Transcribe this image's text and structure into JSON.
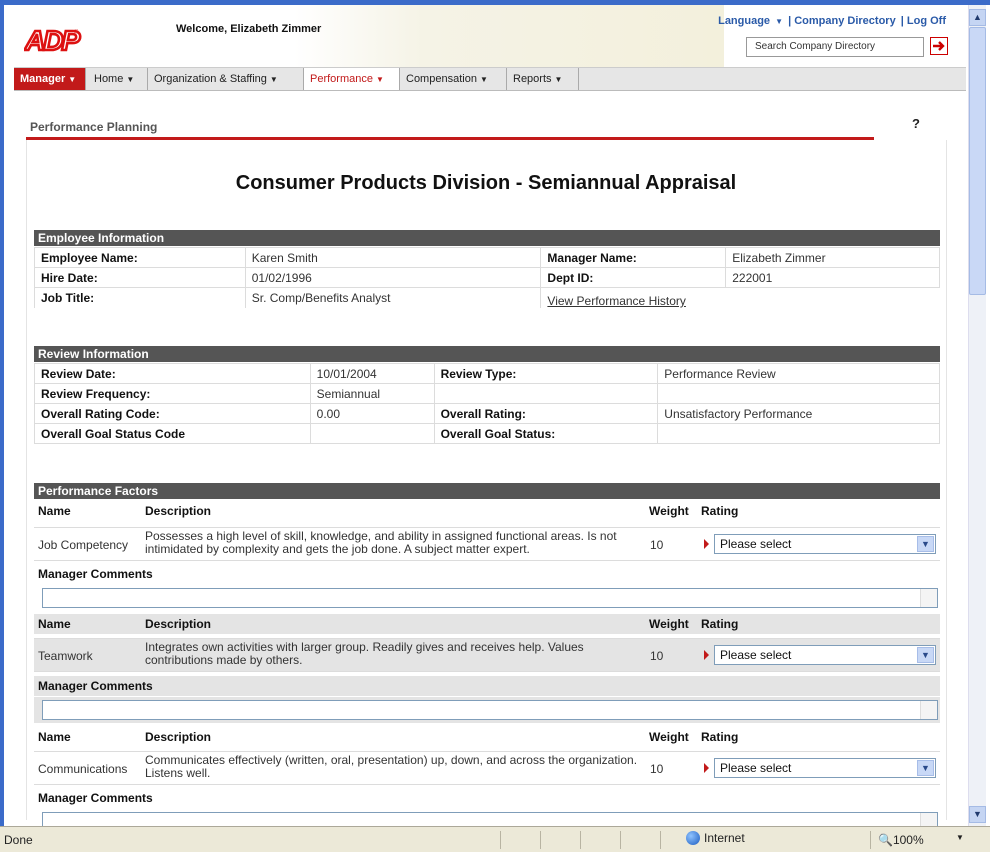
{
  "header": {
    "welcome": "Welcome, Elizabeth Zimmer",
    "language": "Language",
    "company_directory": "| Company Directory",
    "log_off": "| Log Off",
    "search_placeholder": "Search Company Directory"
  },
  "menu": {
    "manager": "Manager",
    "home": "Home",
    "org": "Organization & Staffing",
    "performance": "Performance",
    "compensation": "Compensation",
    "reports": "Reports"
  },
  "page": {
    "title": "Performance Planning",
    "help": "?",
    "heading": "Consumer Products Division - Semiannual Appraisal"
  },
  "employee": {
    "section": "Employee Information",
    "name_label": "Employee Name:",
    "name": "Karen Smith",
    "manager_label": "Manager Name:",
    "manager": "Elizabeth Zimmer",
    "hire_label": "Hire Date:",
    "hire": "01/02/1996",
    "dept_label": "Dept ID:",
    "dept": "222001",
    "job_label": "Job Title:",
    "job": "Sr. Comp/Benefits Analyst",
    "history_link": "View Performance History"
  },
  "review": {
    "section": "Review Information",
    "date_label": "Review Date:",
    "date": "10/01/2004",
    "type_label": "Review Type:",
    "type": "Performance Review",
    "freq_label": "Review Frequency:",
    "freq": "Semiannual",
    "rating_code_label": "Overall Rating Code:",
    "rating_code": "0.00",
    "rating_label": "Overall Rating:",
    "rating": "Unsatisfactory Performance",
    "goal_code_label": "Overall Goal Status Code",
    "goal_label": "Overall Goal Status:"
  },
  "factors": {
    "section": "Performance Factors",
    "col_name": "Name",
    "col_desc": "Description",
    "col_weight": "Weight",
    "col_rating": "Rating",
    "comments_label": "Manager Comments",
    "items": [
      {
        "name": "Job Competency",
        "desc": "Possesses a high level of skill, knowledge, and ability in assigned functional areas. Is not intimidated by complexity and gets the job done. A subject matter expert.",
        "weight": "10",
        "rating": "Please select"
      },
      {
        "name": "Teamwork",
        "desc": "Integrates own activities with larger group. Readily gives and receives help. Values contributions made by others.",
        "weight": "10",
        "rating": "Please select"
      },
      {
        "name": "Communications",
        "desc": "Communicates effectively (written, oral, presentation) up, down, and across the organization. Listens well.",
        "weight": "10",
        "rating": "Please select"
      }
    ]
  },
  "statusbar": {
    "status": "Done",
    "zone": "Internet",
    "zoom": "100%"
  }
}
